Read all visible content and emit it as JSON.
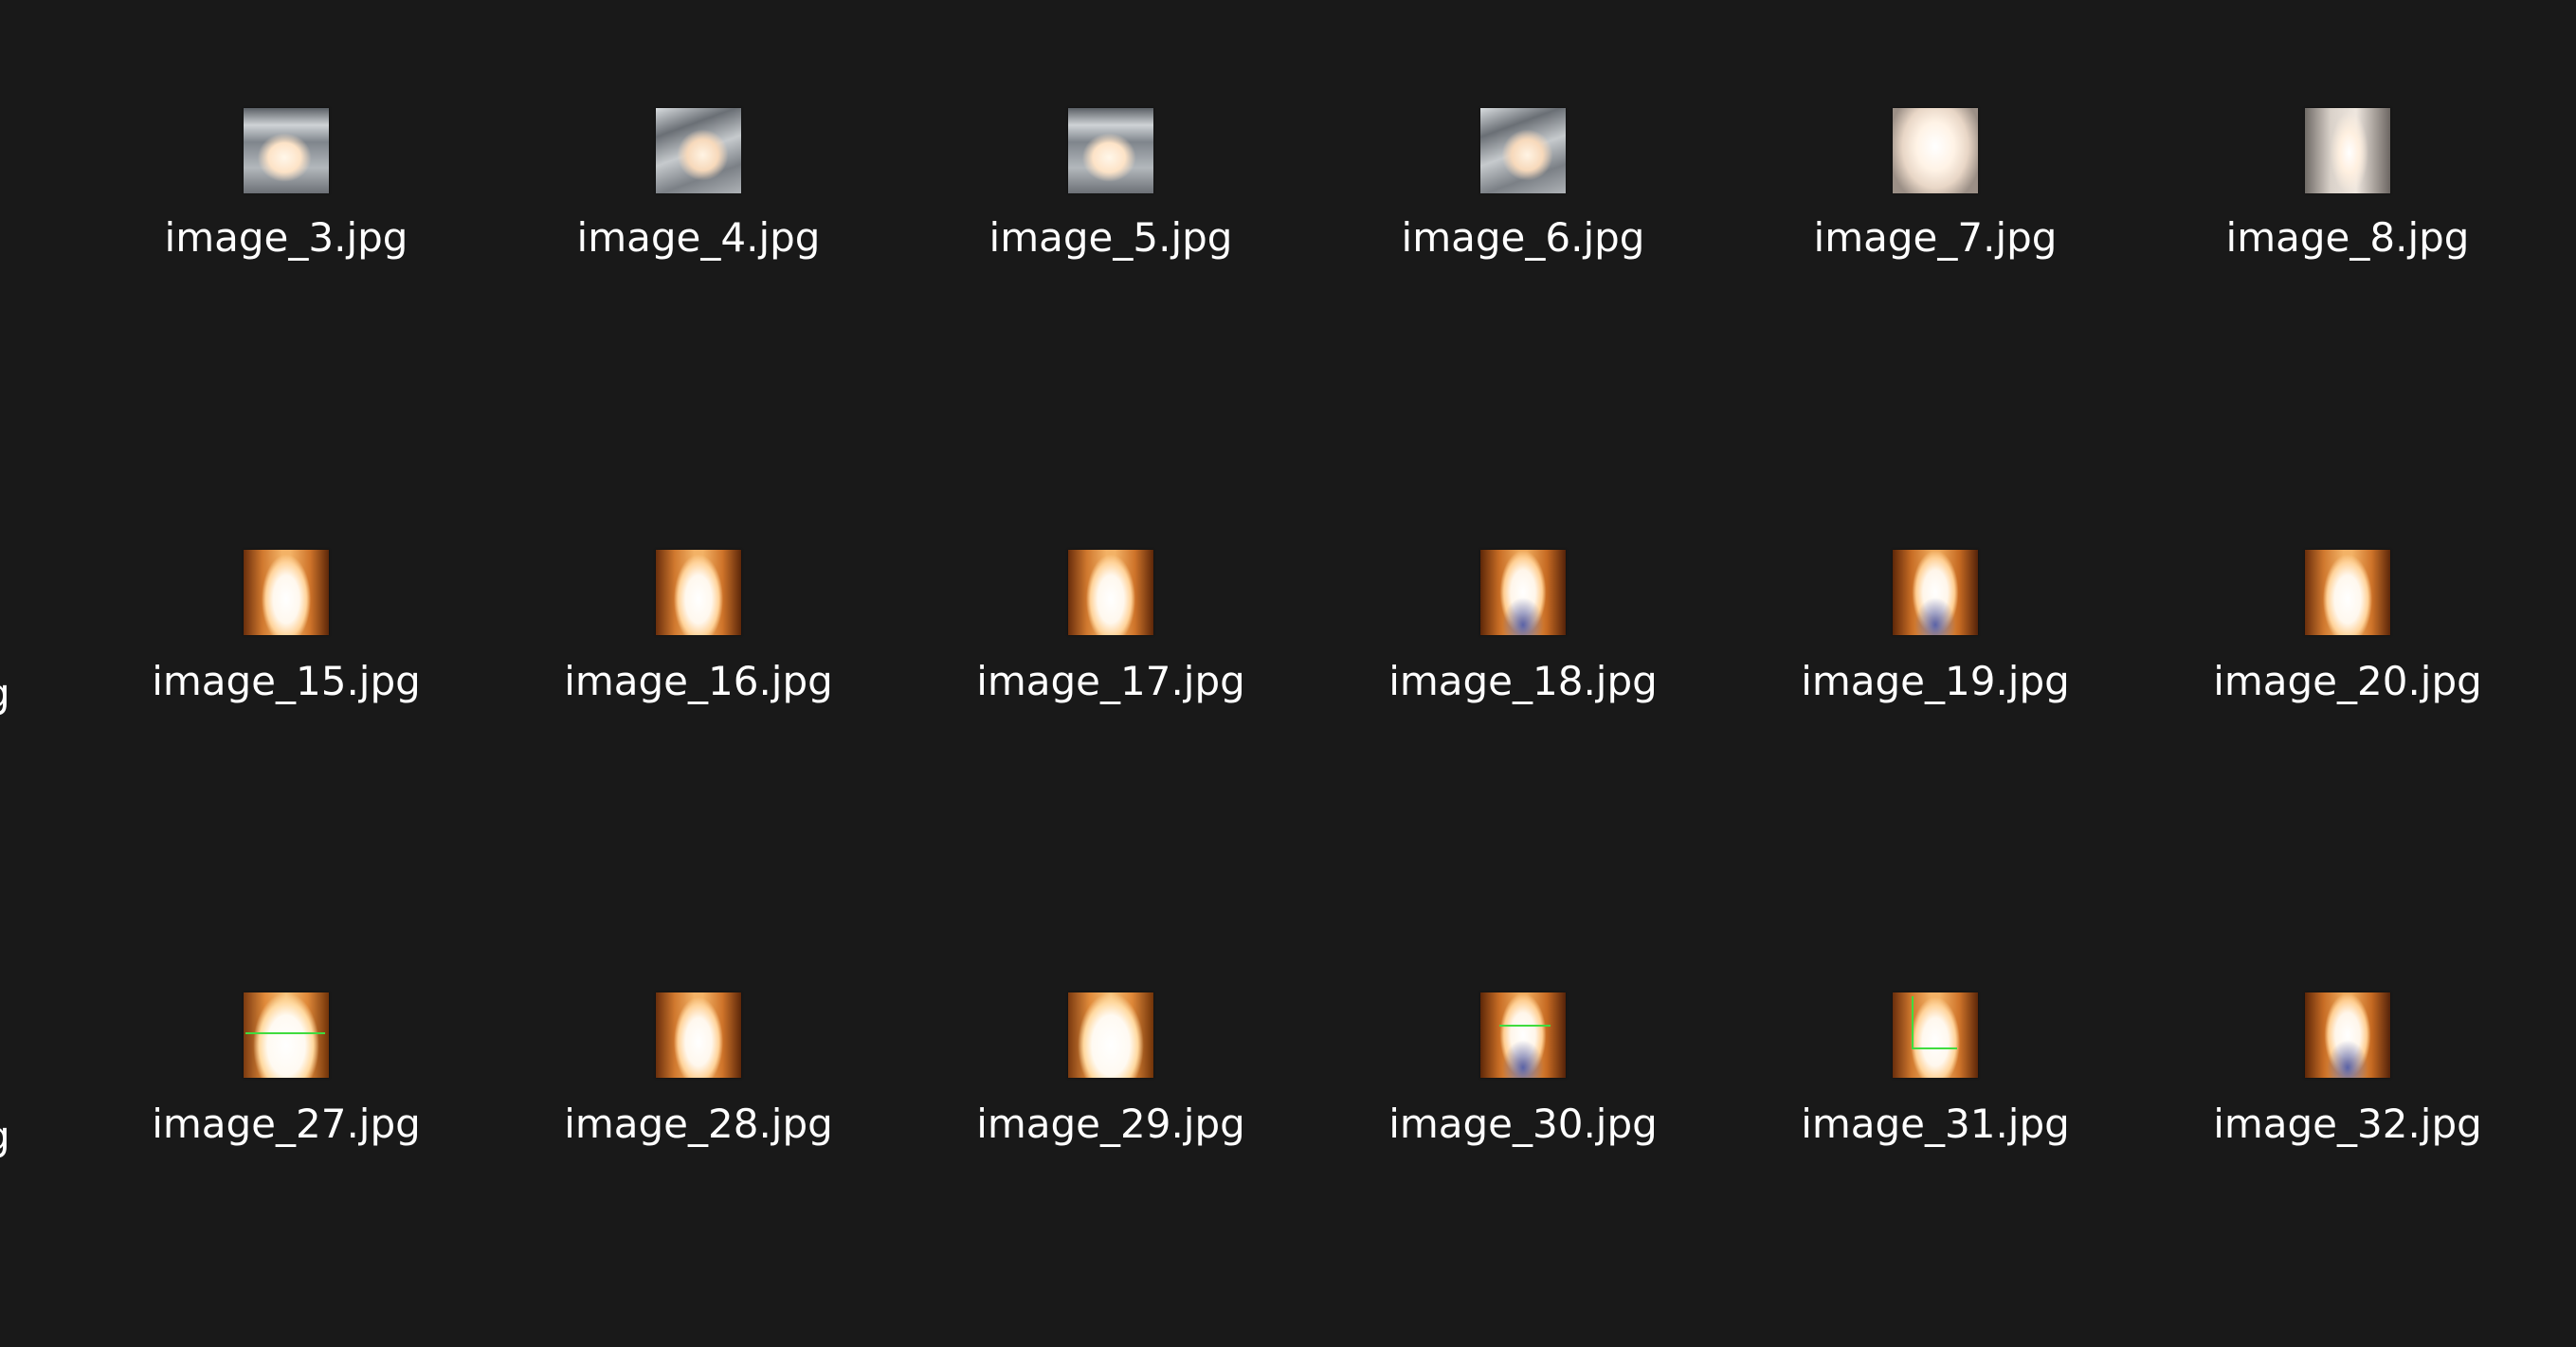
{
  "window": {
    "background": "#191919",
    "label_color": "#ffffff"
  },
  "partial_labels": [
    "g",
    "g"
  ],
  "rows": [
    {
      "files": [
        {
          "name": "image_3.jpg",
          "thumb": "glare"
        },
        {
          "name": "image_4.jpg",
          "thumb": "glare"
        },
        {
          "name": "image_5.jpg",
          "thumb": "glare"
        },
        {
          "name": "image_6.jpg",
          "thumb": "glare"
        },
        {
          "name": "image_7.jpg",
          "thumb": "bright"
        },
        {
          "name": "image_8.jpg",
          "thumb": "bright-tall"
        }
      ]
    },
    {
      "files": [
        {
          "name": "image_15.jpg",
          "thumb": "flame"
        },
        {
          "name": "image_16.jpg",
          "thumb": "flame"
        },
        {
          "name": "image_17.jpg",
          "thumb": "flame"
        },
        {
          "name": "image_18.jpg",
          "thumb": "flame-blue"
        },
        {
          "name": "image_19.jpg",
          "thumb": "flame-blue"
        },
        {
          "name": "image_20.jpg",
          "thumb": "flame"
        }
      ]
    },
    {
      "files": [
        {
          "name": "image_27.jpg",
          "thumb": "flame-wide"
        },
        {
          "name": "image_28.jpg",
          "thumb": "flame"
        },
        {
          "name": "image_29.jpg",
          "thumb": "flame-wide"
        },
        {
          "name": "image_30.jpg",
          "thumb": "flame-blue"
        },
        {
          "name": "image_31.jpg",
          "thumb": "flame"
        },
        {
          "name": "image_32.jpg",
          "thumb": "flame-blue"
        }
      ]
    }
  ]
}
